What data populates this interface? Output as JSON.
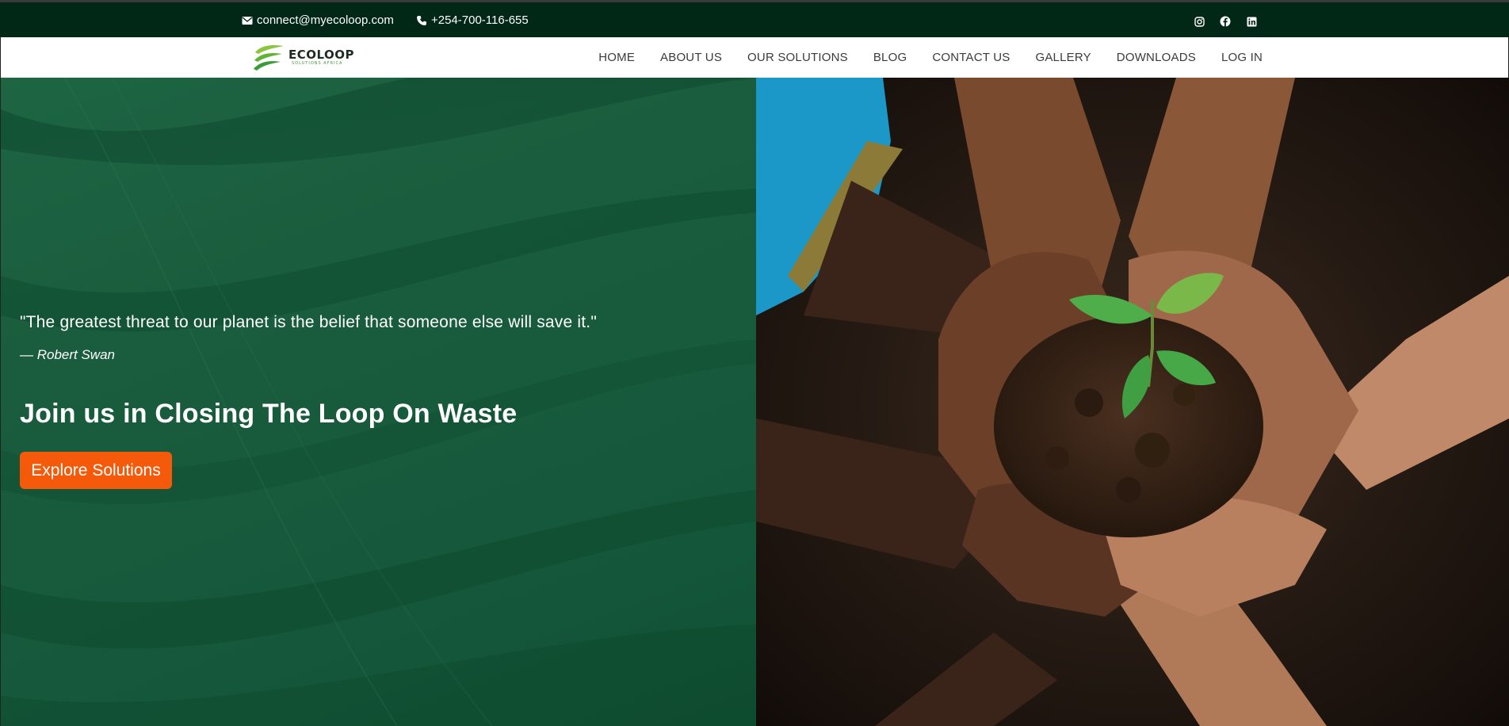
{
  "topbar": {
    "email": "connect@myecoloop.com",
    "phone": "+254-700-116-655",
    "socials": [
      "instagram-icon",
      "facebook-icon",
      "linkedin-icon"
    ]
  },
  "header": {
    "logo": {
      "name": "ECOLOOP",
      "tagline": "SOLUTIONS AFRICA"
    },
    "nav": [
      "HOME",
      "ABOUT US",
      "OUR SOLUTIONS",
      "BLOG",
      "CONTACT US",
      "GALLERY",
      "DOWNLOADS",
      "LOG IN"
    ]
  },
  "hero": {
    "quote": "\"The greatest threat to our planet is the belief that someone else will save it.\"",
    "author": "— Robert Swan",
    "headline": "Join us in Closing The Loop On Waste",
    "cta": "Explore Solutions",
    "image": "hands-holding-seedling-photo"
  },
  "colors": {
    "topbar": "#012716",
    "hero_green": "#1a5d3e",
    "cta": "#f55a0b",
    "nav_text": "#3b3b3b"
  }
}
